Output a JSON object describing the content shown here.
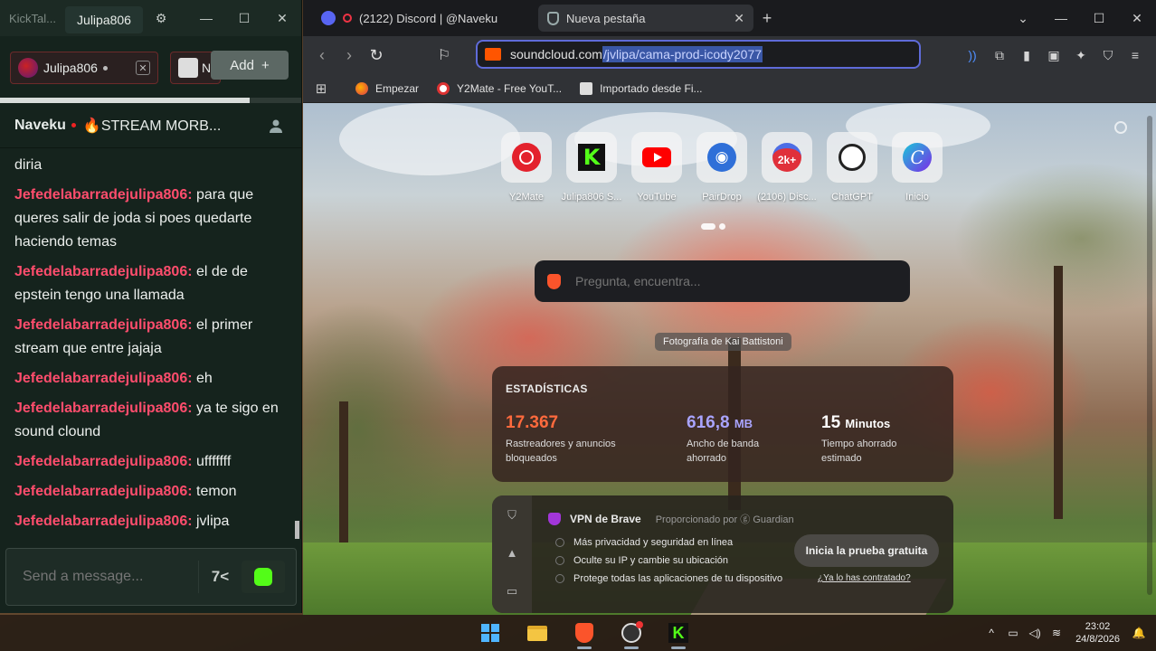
{
  "chat_window": {
    "app_name": "KickTal...",
    "active_tab": "Julipa806",
    "channels": [
      {
        "name": "Julipa806"
      },
      {
        "name": "N"
      }
    ],
    "add_label": "Add",
    "header": {
      "channel": "Naveku",
      "stream_title": "🔥STREAM MORB..."
    },
    "messages": [
      {
        "user": "",
        "text": "diria"
      },
      {
        "user": "Jefedelabarradejulipa806:",
        "text": " para que queres salir de joda si poes quedarte haciendo temas"
      },
      {
        "user": "Jefedelabarradejulipa806:",
        "text": " el de de epstein tengo una llamada"
      },
      {
        "user": "Jefedelabarradejulipa806:",
        "text": " el primer stream que entre jajaja"
      },
      {
        "user": "Jefedelabarradejulipa806:",
        "text": " eh"
      },
      {
        "user": "Jefedelabarradejulipa806:",
        "text": " ya te sigo en sound clound"
      },
      {
        "user": "Jefedelabarradejulipa806:",
        "text": " ufffffff"
      },
      {
        "user": "Jefedelabarradejulipa806:",
        "text": " temon"
      },
      {
        "user": "Jefedelabarradejulipa806:",
        "text": " jvlipa"
      }
    ],
    "input_placeholder": "Send a message...",
    "emote_label": "7<"
  },
  "browser": {
    "tabs": [
      {
        "title": "(2122) Discord | @Naveku",
        "active": false
      },
      {
        "title": "Nueva pestaña",
        "active": true
      }
    ],
    "url_host": "soundcloud.com",
    "url_path": "/jvlipa/cama-prod-icody2077",
    "bookmarks": [
      {
        "label": "Empezar"
      },
      {
        "label": "Y2Mate - Free YouT..."
      },
      {
        "label": "Importado desde Fi..."
      }
    ],
    "shortcuts": [
      {
        "label": "Y2Mate",
        "icon": "y2mate-icon"
      },
      {
        "label": "Julipa806 S...",
        "icon": "kick-icon"
      },
      {
        "label": "YouTube",
        "icon": "youtube-icon"
      },
      {
        "label": "PairDrop",
        "icon": "pairdrop-icon"
      },
      {
        "label": "(2106) Disc...",
        "icon": "discord-icon",
        "badge": "2k+"
      },
      {
        "label": "ChatGPT",
        "icon": "chatgpt-icon"
      },
      {
        "label": "Inicio",
        "icon": "canva-icon",
        "glyph": "C"
      }
    ],
    "search_placeholder": "Pregunta, encuentra...",
    "photo_credit": "Fotografía de Kai Battistoni",
    "stats": {
      "title": "ESTADÍSTICAS",
      "trackers": {
        "value": "17.367",
        "unit": "",
        "label": "Rastreadores y anuncios bloqueados",
        "color": "#ff6a3d"
      },
      "bandwidth": {
        "value": "616,8",
        "unit": "MB",
        "label": "Ancho de banda ahorrado",
        "color": "#a9a4ff"
      },
      "time": {
        "value": "15",
        "unit": "Minutos",
        "label": "Tiempo ahorrado estimado",
        "color": "#ffffff"
      }
    },
    "vpn": {
      "name": "VPN de Brave",
      "provided_by": "Proporcionado por ⓖ Guardian",
      "features": [
        "Más privacidad y seguridad en línea",
        "Oculte su IP y cambie su ubicación",
        "Protege todas las aplicaciones de tu dispositivo"
      ],
      "trial_button": "Inicia la prueba gratuita",
      "already_link": "¿Ya lo has contratado?"
    }
  },
  "taskbar": {
    "time": "23:02",
    "date": "24/8/2026"
  }
}
